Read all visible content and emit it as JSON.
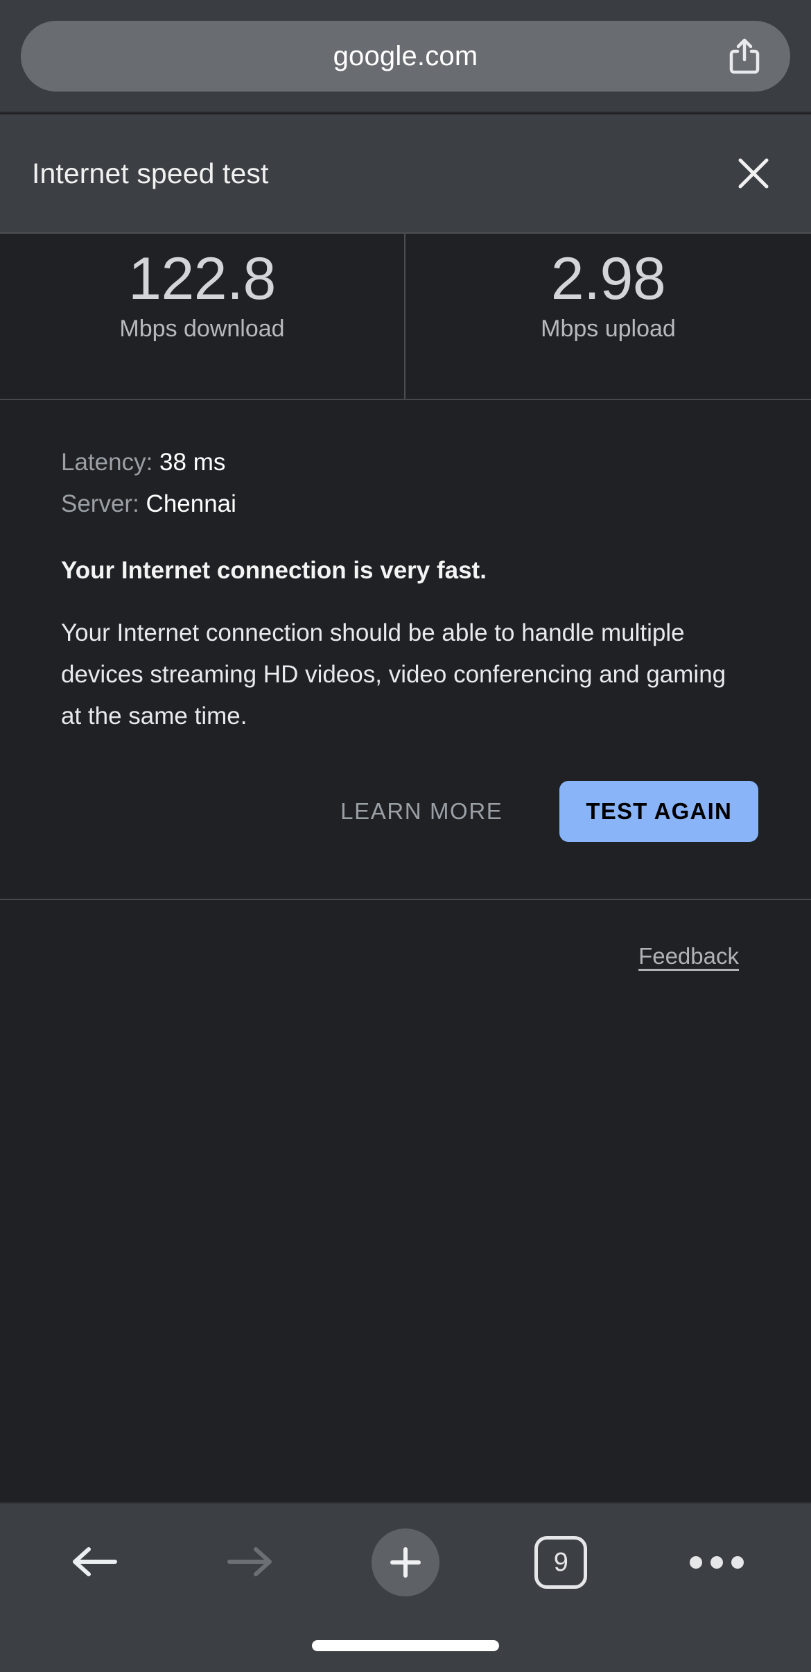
{
  "browser": {
    "url": "google.com",
    "share_icon": "share-icon"
  },
  "speed_test": {
    "title": "Internet speed test",
    "close_icon": "close-icon",
    "download": {
      "value": "122.8",
      "label": "Mbps download"
    },
    "upload": {
      "value": "2.98",
      "label": "Mbps upload"
    },
    "latency_key": "Latency:",
    "latency_value": "38 ms",
    "server_key": "Server:",
    "server_value": "Chennai",
    "summary_headline": "Your Internet connection is very fast.",
    "summary_body": "Your Internet connection should be able to handle multiple devices streaming HD videos, video conferencing and gaming at the same time.",
    "learn_more_label": "LEARN MORE",
    "test_again_label": "TEST AGAIN",
    "accent_color": "#8ab4f8",
    "feedback_label": "Feedback"
  },
  "toolbar": {
    "back_icon": "arrow-left-icon",
    "forward_icon": "arrow-right-icon",
    "new_tab_icon": "plus-icon",
    "tab_count": "9",
    "more_icon": "ellipsis-icon"
  }
}
